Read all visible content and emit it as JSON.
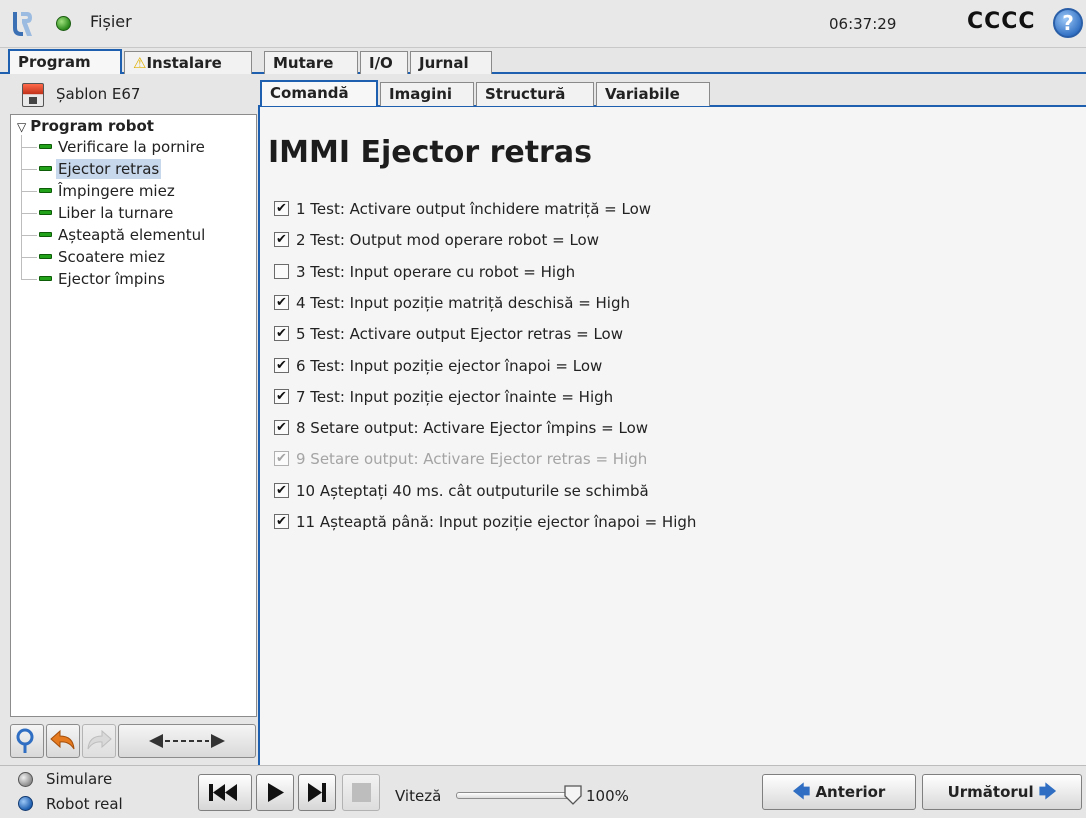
{
  "header": {
    "file_menu": "Fișier",
    "clock": "06:37:29",
    "robot_name": "CCCC",
    "help_icon": "help-circle-icon"
  },
  "main_tabs": [
    {
      "label": "Program",
      "active": true
    },
    {
      "label": "Instalare",
      "warning": true
    },
    {
      "label": "Mutare"
    },
    {
      "label": "I/O"
    },
    {
      "label": "Jurnal"
    }
  ],
  "template": {
    "label": "Șablon E67"
  },
  "tree": {
    "root": "Program robot",
    "items": [
      {
        "label": "Verificare la pornire"
      },
      {
        "label": "Ejector retras",
        "selected": true
      },
      {
        "label": "Împingere miez"
      },
      {
        "label": "Liber la turnare"
      },
      {
        "label": "Așteaptă elementul"
      },
      {
        "label": "Scoatere miez"
      },
      {
        "label": "Ejector împins"
      }
    ]
  },
  "sub_tabs": [
    {
      "label": "Comandă",
      "active": true
    },
    {
      "label": "Imagini"
    },
    {
      "label": "Structură"
    },
    {
      "label": "Variabile"
    }
  ],
  "content": {
    "title": "IMMI Ejector retras",
    "checks": [
      {
        "text": "1 Test: Activare output închidere matriță = Low",
        "checked": true
      },
      {
        "text": "2 Test: Output mod operare robot = Low",
        "checked": true
      },
      {
        "text": "3 Test: Input operare cu robot = High",
        "checked": false
      },
      {
        "text": "4 Test: Input poziție matriță deschisă = High",
        "checked": true
      },
      {
        "text": "5 Test: Activare output Ejector retras = Low",
        "checked": true
      },
      {
        "text": "6 Test: Input poziție ejector înapoi = Low",
        "checked": true
      },
      {
        "text": "7 Test: Input poziție ejector înainte = High",
        "checked": true
      },
      {
        "text": "8 Setare output: Activare Ejector împins = Low",
        "checked": true
      },
      {
        "text": "9 Setare output: Activare Ejector retras = High",
        "checked": true,
        "disabled": true
      },
      {
        "text": "10 Așteptați 40 ms. cât outputurile se schimbă",
        "checked": true
      },
      {
        "text": "11 Așteaptă până: Input poziție ejector înapoi = High",
        "checked": true
      }
    ]
  },
  "bottom": {
    "simulate_label": "Simulare",
    "real_robot_label": "Robot real",
    "speed_label": "Viteză",
    "speed_value": "100%",
    "speed_fraction": 1.0,
    "prev_label": "Anterior",
    "next_label": "Următorul"
  },
  "colors": {
    "accent_blue": "#1f5fb0",
    "status_green": "#2b8a1b",
    "node_green": "#22a11a",
    "selection": "#c8d8ec"
  }
}
